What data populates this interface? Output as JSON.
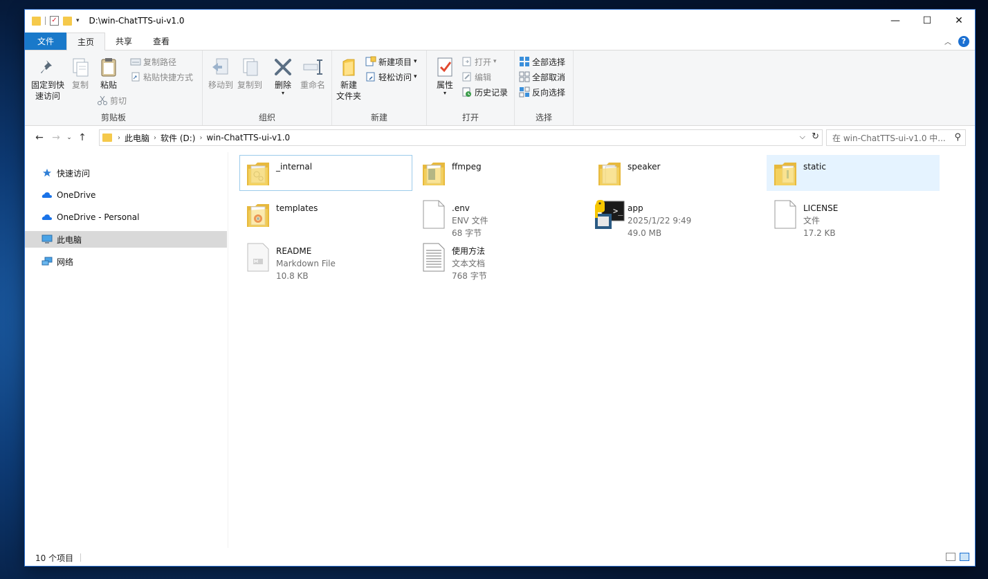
{
  "window": {
    "title": "D:\\win-ChatTTS-ui-v1.0",
    "controls": {
      "minimize": "—",
      "maximize": "☐",
      "close": "✕"
    }
  },
  "ribbon_tabs": [
    {
      "label": "文件"
    },
    {
      "label": "主页"
    },
    {
      "label": "共享"
    },
    {
      "label": "查看"
    }
  ],
  "ribbon": {
    "clipboard": {
      "pin_label_1": "固定到快",
      "pin_label_2": "速访问",
      "copy": "复制",
      "paste": "粘贴",
      "copy_path": "复制路径",
      "paste_shortcut": "粘贴快捷方式",
      "cut": "剪切",
      "group": "剪贴板"
    },
    "organize": {
      "move_to": "移动到",
      "copy_to": "复制到",
      "delete": "删除",
      "rename": "重命名",
      "group": "组织"
    },
    "new": {
      "new_folder_1": "新建",
      "new_folder_2": "文件夹",
      "new_item": "新建项目",
      "easy_access": "轻松访问",
      "group": "新建"
    },
    "open": {
      "properties": "属性",
      "open": "打开",
      "edit": "编辑",
      "history": "历史记录",
      "group": "打开"
    },
    "select": {
      "select_all": "全部选择",
      "select_none": "全部取消",
      "invert": "反向选择",
      "group": "选择"
    }
  },
  "address": {
    "crumbs": [
      "此电脑",
      "软件 (D:)",
      "win-ChatTTS-ui-v1.0"
    ],
    "search_placeholder": "在 win-ChatTTS-ui-v1.0 中..."
  },
  "nav_pane": [
    {
      "label": "快速访问",
      "icon": "star-icon"
    },
    {
      "label": "OneDrive",
      "icon": "cloud-icon"
    },
    {
      "label": "OneDrive - Personal",
      "icon": "cloud-icon"
    },
    {
      "label": "此电脑",
      "icon": "computer-icon"
    },
    {
      "label": "网络",
      "icon": "network-icon"
    }
  ],
  "files": [
    {
      "name": "_internal",
      "line2": "",
      "line3": "",
      "kind": "folder"
    },
    {
      "name": "ffmpeg",
      "line2": "",
      "line3": "",
      "kind": "folder"
    },
    {
      "name": "speaker",
      "line2": "",
      "line3": "",
      "kind": "folder"
    },
    {
      "name": "static",
      "line2": "",
      "line3": "",
      "kind": "folder"
    },
    {
      "name": "templates",
      "line2": "",
      "line3": "",
      "kind": "folder"
    },
    {
      "name": ".env",
      "line2": "ENV 文件",
      "line3": "68 字节",
      "kind": "file"
    },
    {
      "name": "app",
      "line2": "2025/1/22 9:49",
      "line3": "49.0 MB",
      "kind": "exe"
    },
    {
      "name": "LICENSE",
      "line2": "文件",
      "line3": "17.2 KB",
      "kind": "file"
    },
    {
      "name": "README",
      "line2": "Markdown File",
      "line3": "10.8 KB",
      "kind": "md"
    },
    {
      "name": "使用方法",
      "line2": "文本文档",
      "line3": "768 字节",
      "kind": "txt"
    }
  ],
  "status": {
    "count": "10 个项目"
  },
  "colors": {
    "file_tab": "#1979ca",
    "selection": "#e5f3ff",
    "folder": "#f5c94b"
  }
}
